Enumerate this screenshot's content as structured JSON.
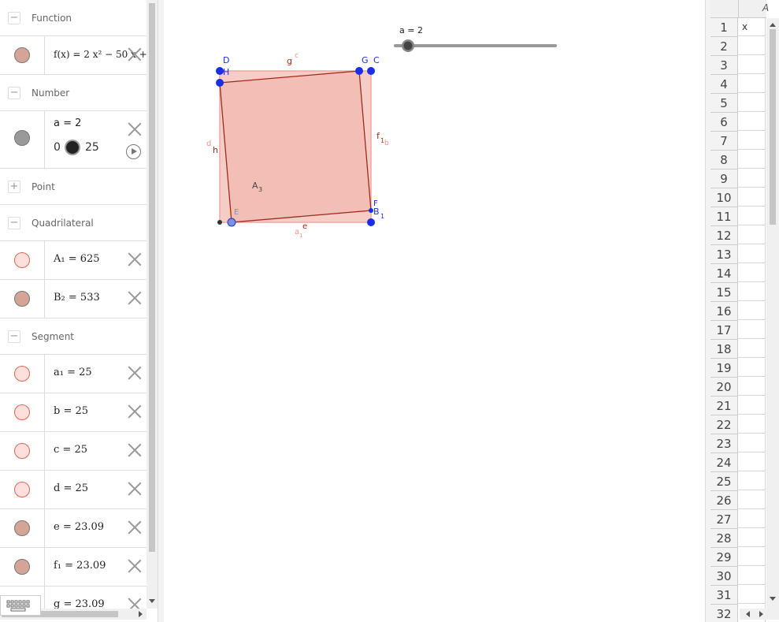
{
  "algebra": {
    "categories": {
      "function": "Function",
      "number": "Number",
      "point": "Point",
      "quadrilateral": "Quadrilateral",
      "segment": "Segment"
    },
    "toggle_collapse": "−",
    "toggle_expand": "+",
    "function_f": "f(x) = 2 x² − 50 x +",
    "slider": {
      "definition": "a = 2",
      "min": "0",
      "max": "25",
      "value_fraction": 0.08
    },
    "A1": "A₁ = 625",
    "B2": "B₂ = 533",
    "a1": "a₁ = 25",
    "b": "b = 25",
    "c": "c = 25",
    "d": "d = 25",
    "e": "e = 23.09",
    "f1": "f₁ = 23.09",
    "g": "g = 23.09"
  },
  "graphics": {
    "slider_label": "a = 2",
    "labels": {
      "D": "D",
      "H": "H",
      "G": "G",
      "C": "C",
      "c": "c",
      "g": "g",
      "d": "d",
      "h": "h",
      "f": "f",
      "f_sub": "1",
      "b": "b",
      "A3": "A",
      "A3_sub": "3",
      "E": "E",
      "F": "F",
      "B": "B",
      "B_sub": "1",
      "e": "e",
      "a": "a",
      "a_sub": "1"
    }
  },
  "spreadsheet": {
    "column_header": "A",
    "rows": [
      "1",
      "2",
      "3",
      "4",
      "5",
      "6",
      "7",
      "8",
      "9",
      "10",
      "11",
      "12",
      "13",
      "14",
      "15",
      "16",
      "17",
      "18",
      "19",
      "20",
      "21",
      "22",
      "23",
      "24",
      "25",
      "26",
      "27",
      "28",
      "29",
      "30",
      "31",
      "32"
    ],
    "a1_value": "x"
  },
  "colors": {
    "fill": "#f4c6c0",
    "outer_stroke": "#f4a7a0",
    "inner_stroke": "#9b2d1c",
    "point_blue": "#1a2ee6",
    "marker_pink": "#fde0dc",
    "marker_brown": "#d4a596",
    "marker_gray": "#999999"
  }
}
